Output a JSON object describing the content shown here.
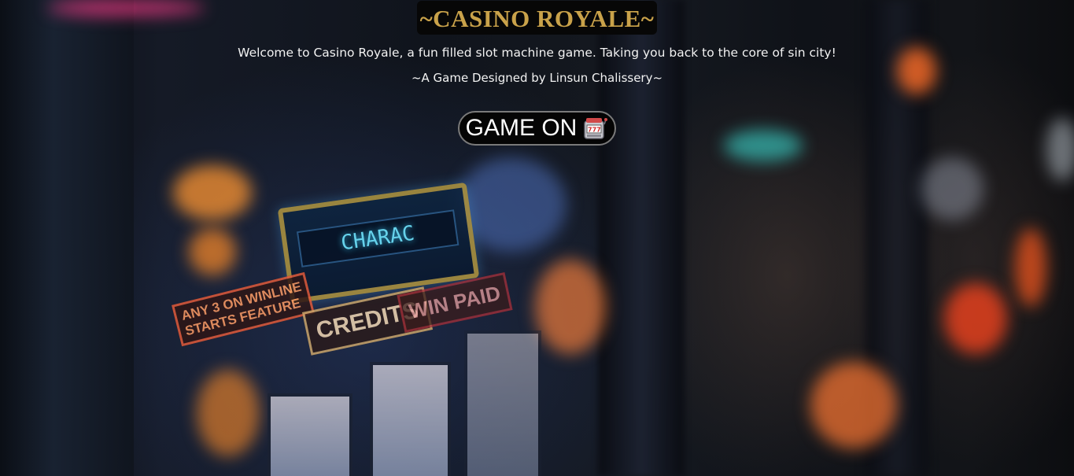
{
  "header": {
    "title": "~CASINO ROYALE~",
    "tagline": "Welcome to Casino Royale, a fun filled slot machine game. Taking you back to the core of sin city!",
    "credit": "~A Game Designed by Linsun Chalissery~"
  },
  "main": {
    "game_on_label": "GAME ON",
    "game_on_icon": "slot-machine-icon"
  },
  "background": {
    "description_icon": "blurred-slot-machines-photo"
  },
  "colors": {
    "title_gold": "#c9a24a",
    "text_white": "#f2f2f2",
    "button_bg": "#050505"
  }
}
